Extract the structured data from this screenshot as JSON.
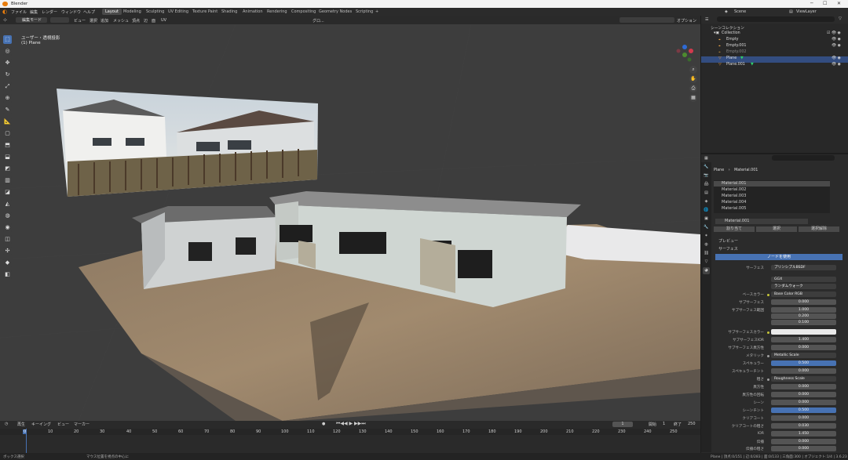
{
  "app": {
    "title": "Blender"
  },
  "menu": [
    "ファイル",
    "編集",
    "レンダー",
    "ウィンドウ",
    "ヘルプ"
  ],
  "workspaces": [
    "Layout",
    "Modeling",
    "Sculpting",
    "UV Editing",
    "Texture Paint",
    "Shading",
    "Animation",
    "Rendering",
    "Compositing",
    "Geometry Nodes",
    "Scripting",
    "+"
  ],
  "scene": {
    "name": "Scene",
    "view_layer": "ViewLayer"
  },
  "viewport_header": {
    "mode": "編集モード",
    "menus": [
      "ビュー",
      "選択",
      "追加",
      "メッシュ",
      "頂点",
      "辺",
      "面",
      "UV"
    ],
    "transform": "グロ...",
    "options": "オプション"
  },
  "viewport": {
    "view_name": "ユーザー・透視投影",
    "object": "(1) Plane"
  },
  "outliner": {
    "root": "シーンコレクション",
    "rows": [
      {
        "name": "Collection"
      },
      {
        "name": "Empty"
      },
      {
        "name": "Empty.001"
      },
      {
        "name": "Empty.002"
      },
      {
        "name": "Plane"
      },
      {
        "name": "Plane.001"
      }
    ]
  },
  "properties": {
    "breadcrumb_object": "Plane",
    "breadcrumb_material": "Material.001",
    "slots": [
      "Material.001",
      "Material.002",
      "Material.003",
      "Material.004",
      "Material.005"
    ],
    "material_name": "Material.001",
    "slot_buttons": [
      "割り当て",
      "選択",
      "選択解除"
    ],
    "preview_label": "プレビュー",
    "surface_label": "サーフェス",
    "use_nodes": "ノードを使用",
    "rows": [
      {
        "label": "サーフェス",
        "value": "プリンシプルBSDF"
      },
      {
        "label": "",
        "value": "GGX"
      },
      {
        "label": "",
        "value": "ランダムウォーク"
      },
      {
        "label": "ベースカラー",
        "value": "Base Color RGB"
      },
      {
        "label": "サブサーフェス",
        "value": "0.000"
      },
      {
        "label": "サブサーフェス範囲",
        "value": "1.000"
      },
      {
        "label": "",
        "value": "0.200"
      },
      {
        "label": "",
        "value": "0.100"
      },
      {
        "label": "サブサーフェスカラー",
        "value": ""
      },
      {
        "label": "サブサーフェスIOR",
        "value": "1.400"
      },
      {
        "label": "サブサーフェス異方性",
        "value": "0.000"
      },
      {
        "label": "メタリック",
        "value": "Metallic Scale"
      },
      {
        "label": "スペキュラー",
        "value": "0.500"
      },
      {
        "label": "スペキュラーチント",
        "value": "0.000"
      },
      {
        "label": "粗さ",
        "value": "Roughness Scale"
      },
      {
        "label": "異方性",
        "value": "0.000"
      },
      {
        "label": "異方性の回転",
        "value": "0.000"
      },
      {
        "label": "シーン",
        "value": "0.000"
      },
      {
        "label": "シーンチント",
        "value": "0.500"
      },
      {
        "label": "クリアコート",
        "value": "0.000"
      },
      {
        "label": "クリアコートの粗さ",
        "value": "0.030"
      },
      {
        "label": "IOR",
        "value": "1.450"
      },
      {
        "label": "伝播",
        "value": "0.000"
      },
      {
        "label": "伝播の粗さ",
        "value": "0.000"
      }
    ]
  },
  "timeline": {
    "menus": [
      "再生",
      "キーイング",
      "ビュー",
      "マーカー"
    ],
    "current": "1",
    "start_label": "開始",
    "start": "1",
    "end_label": "終了",
    "end": "250",
    "ticks": [
      "0",
      "10",
      "20",
      "30",
      "40",
      "50",
      "60",
      "70",
      "80",
      "90",
      "100",
      "110",
      "120",
      "130",
      "140",
      "150",
      "160",
      "170",
      "180",
      "190",
      "200",
      "210",
      "220",
      "230",
      "240",
      "250"
    ]
  },
  "status": {
    "left": "ボックス選択",
    "mid": "マウス位置を視点の中心に",
    "right": "Plane | 頂点:0/151 | 辺:0/283 | 面:0/133 | 三角面:300 | オブジェクト:1/4 | 3.6.23"
  },
  "colors": {
    "accent": "#4772b3",
    "select": "#e87d0d"
  }
}
